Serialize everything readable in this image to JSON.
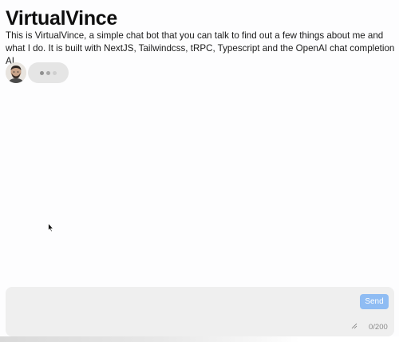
{
  "header": {
    "title": "VirtualVince",
    "description": "This is VirtualVince, a simple chat bot that you can talk to find out a few things about me and what I do. It is built with NextJS, Tailwindcss, tRPC, Typescript and the OpenAI chat completion AI."
  },
  "chat": {
    "bot_avatar_icon": "bot-avatar-photo",
    "typing_indicator_icon": "typing-dots-icon"
  },
  "composer": {
    "message_value": "",
    "send_label": "Send",
    "char_count": "0/200",
    "resize_icon": "resize-handle-icon",
    "send_color": "#8fbcf3"
  },
  "colors": {
    "background": "#fdfdfe",
    "composer_bg": "#efefef",
    "bubble_bg": "#e5e5e5",
    "send_button": "#8fbcf3"
  }
}
